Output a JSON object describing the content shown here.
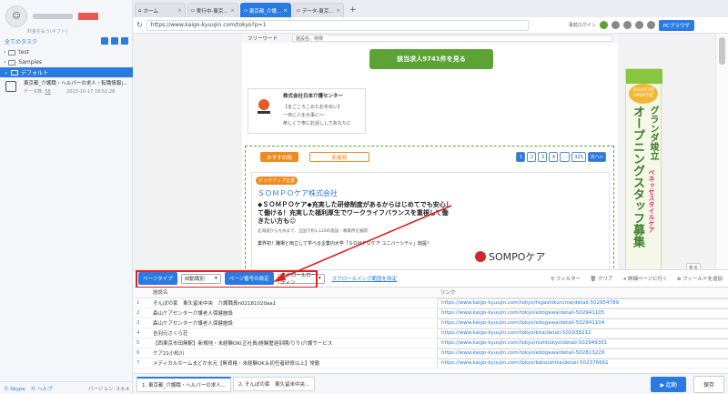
{
  "left": {
    "sub_label": "料金を払う(ギフト)",
    "tasks_title": "全てのタスク",
    "tree": [
      {
        "label": "test",
        "selected": false
      },
      {
        "label": "Samples",
        "selected": false
      },
      {
        "label": "デフォルト",
        "selected": true
      }
    ],
    "task": {
      "name": "東京都_介護職・ヘルパーの求人・転職情報|...",
      "meta_label": "データ数:",
      "meta_count": "58",
      "date": "2023-10-17 16:51:28"
    },
    "footer": {
      "skype": "Skype",
      "help": "ヘルプ",
      "version": "バージョン: 3.6.4"
    }
  },
  "browser": {
    "tabs": [
      {
        "label": "ホーム",
        "active": false
      },
      {
        "label": "実行中-東京...",
        "active": false
      },
      {
        "label": "東京都_介護...",
        "active": true
      },
      {
        "label": "データ-東京...",
        "active": false
      }
    ],
    "url": "https://www.kaigo-kyuujin.com/tokyo?p=1",
    "login_pre": "事前ログイン",
    "pc_browser": "PCブラウザ"
  },
  "page": {
    "free_word_label": "フリーワード",
    "free_word_placeholder": "施設名、特徴",
    "search_button": "該当求人9741件を見る",
    "corp": {
      "name": "株式会社日本介護センター",
      "lines": [
        "【まごころこめたお手伝い】",
        "一歩に人を大事に〜",
        "恭しく丁寧にお話ししてあなたに"
      ]
    },
    "pills": {
      "recommend": "おすすめ順",
      "newest": "新着順"
    },
    "pager": [
      "1",
      "2",
      "3",
      "4",
      "...",
      "325",
      "次へ>"
    ],
    "card": {
      "badge": "ピックアップ企業",
      "company": "ＳＯＭＰＯケア株式会社",
      "catch": "◆ＳＯＭＰＯケア◆充実した研修制度があるからはじめてでも安心して働ける！充実した福利厚生でワークライフバランスを重視して働きたい方も☺",
      "loc": "北海道から九州まで、全国で約1,120の施設・事業所を展開",
      "desc": "業界初！職場と両立して学べる企業内大学「ＳＯＭＰＯケア ユニバーシティ」創設！",
      "logo_text": "SOMPOケア"
    },
    "ad": {
      "oval": "2024年3月 OPEN予定",
      "v1": "オープニングスタッフ募集",
      "v2": "グランダ竣立",
      "v3": "ベネッセスタイルケア"
    },
    "scroll_hint": "折る"
  },
  "extract": {
    "page_type_btn": "ページタイプ",
    "page_type_val": "自動識別",
    "pagination_btn": "ページ番号の設定",
    "pagination_val": "スクロールローディン",
    "scroll_link": "スクロールイング範囲を設定",
    "tools": [
      "フィルター",
      "クリア",
      "詳細ページに行く",
      "フィールドを追加"
    ]
  },
  "table": {
    "headers": [
      "",
      "施設名",
      "リンク"
    ],
    "rows": [
      [
        "1",
        "そんぽの家　東久留米中央　介護職員n02181020aa1",
        "https://www.kaigo-kyuujin.com/tokyo/higashikurume/detail-502954789"
      ],
      [
        "2",
        "森山ケアセンター介護老人保健施設",
        "https://www.kaigo-kyuujin.com/tokyo/edogawa/detail-502941105"
      ],
      [
        "3",
        "森山ケアセンター介護老人保健施設",
        "https://www.kaigo-kyuujin.com/tokyo/edogawa/detail-502941104"
      ],
      [
        "4",
        "吉羽元さくら荘",
        "https://www.kaigo-kyuujin.com/tokyo/kita/detail-502938212"
      ],
      [
        "5",
        "【西東京市田無駅】新規地・未経験OK(正社員/経験歴遅刻期/りり)介護サービス",
        "https://www.kaigo-kyuujin.com/tokyo/nishitokyo/detail-502949301"
      ],
      [
        "6",
        "ケア21小松川",
        "https://www.kaigo-kyuujin.com/tokyo/edogawa/detail-502813229"
      ],
      [
        "7",
        "メディカルホームまどか水元【無資格・未経験OK＆初任者研修以上】常勤",
        "https://www.kaigo-kyuujin.com/tokyo/katsushika/detail-502376661"
      ]
    ]
  },
  "bottom": {
    "tabs": [
      "1. 東京都_介護職・ヘルパーの求人...",
      "2. そんぽの家　東久留米中央..."
    ],
    "run": "▶ 起動",
    "save": "保存"
  }
}
